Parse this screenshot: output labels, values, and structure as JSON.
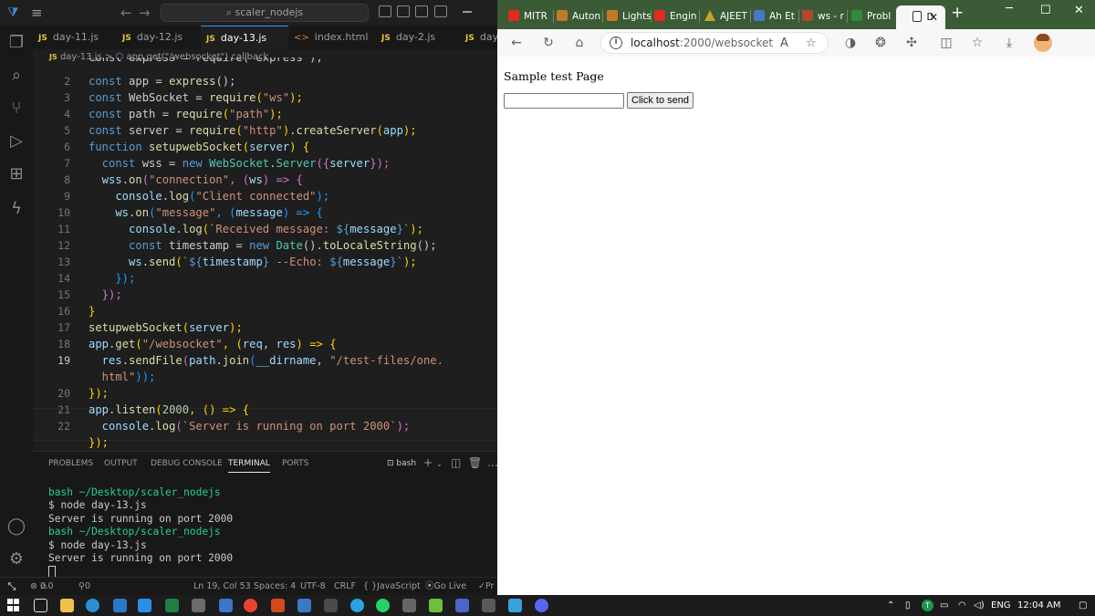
{
  "vscode": {
    "search_text": "scaler_nodejs",
    "tabs": [
      {
        "label": "day-11.js",
        "type": "JS"
      },
      {
        "label": "day-12.js",
        "type": "JS"
      },
      {
        "label": "day-13.js",
        "type": "JS",
        "active": true
      },
      {
        "label": "index.html",
        "type": "<>"
      },
      {
        "label": "day-2.js",
        "type": "JS"
      },
      {
        "label": "day-",
        "type": "JS"
      }
    ],
    "breadcrumb": {
      "file": "day-13.js",
      "sep": ">",
      "symbol": "app.get(\"/websocket\") callback"
    },
    "line_numbers": [
      "2",
      "3",
      "4",
      "5",
      "6",
      "7",
      "8",
      "9",
      "10",
      "11",
      "12",
      "13",
      "14",
      "15",
      "16",
      "17",
      "18",
      "19",
      "",
      "20",
      "21",
      "22"
    ],
    "code": {
      "l1_partial": "const express = require(\"express\");",
      "l2": [
        "const",
        " app = ",
        "express",
        "();"
      ],
      "l3": [
        "const",
        " WebSocket = ",
        "require",
        "(",
        "\"ws\"",
        ");"
      ],
      "l4": [
        "const",
        " path = ",
        "require",
        "(",
        "\"path\"",
        ");"
      ],
      "l5": [
        "const",
        " server = ",
        "require",
        "(",
        "\"http\"",
        ").",
        "createServer",
        "(",
        "app",
        ");"
      ],
      "l6": [
        "function",
        " ",
        "setupwebSocket",
        "(",
        "server",
        ") {"
      ],
      "l7": [
        "  const",
        " wss = ",
        "new",
        " WebSocket",
        ".",
        "Server",
        "({",
        "server",
        "});"
      ],
      "l8": [
        "  wss",
        ".",
        "on",
        "(",
        "\"connection\"",
        ", (",
        "ws",
        ") => {"
      ],
      "l9": [
        "    console",
        ".",
        "log",
        "(",
        "\"Client connected\"",
        ");"
      ],
      "l10": [
        "    ws",
        ".",
        "on",
        "(",
        "\"message\"",
        ", (",
        "message",
        ") => {"
      ],
      "l11": [
        "      console",
        ".",
        "log",
        "(",
        "`Received message: ",
        "${",
        "message",
        "}",
        "`",
        ");"
      ],
      "l12": [
        "      const",
        " timestamp = ",
        "new",
        " Date",
        "().",
        "toLocaleString",
        "();"
      ],
      "l13": [
        "      ws",
        ".",
        "send",
        "(",
        "`",
        "${",
        "timestamp",
        "}",
        " --Echo: ",
        "${",
        "message",
        "}",
        "`",
        ");"
      ],
      "l14": [
        "    });"
      ],
      "l15": [
        "  });"
      ],
      "l16": [
        "}"
      ],
      "l17": [
        "setupwebSocket",
        "(",
        "server",
        ");"
      ],
      "l18": [
        "app",
        ".",
        "get",
        "(",
        "\"/websocket\"",
        ", (",
        "req",
        ", ",
        "res",
        ") => {"
      ],
      "l19a": [
        "  res",
        ".",
        "sendFile",
        "(",
        "path",
        ".",
        "join",
        "(",
        "__dirname",
        ", ",
        "\"/test-files/one."
      ],
      "l19b": [
        "  html\"",
        "));"
      ],
      "l20": [
        "});"
      ],
      "l21": [
        "app",
        ".",
        "listen",
        "(",
        "2000",
        ", () => {"
      ],
      "l22": [
        "  console",
        ".",
        "log",
        "(",
        "`Server is running on port 2000`",
        ");"
      ],
      "l23": [
        "});"
      ]
    },
    "panel_tabs": [
      "PROBLEMS",
      "OUTPUT",
      "DEBUG CONSOLE",
      "TERMINAL",
      "PORTS"
    ],
    "active_panel_tab": "TERMINAL",
    "terminal_shell": "bash",
    "terminal_lines": [
      {
        "prompt": "bash ~/Desktop/scaler_nodejs",
        "green": true
      },
      {
        "text": "$ node day-13.js"
      },
      {
        "text": "Server is running on port 2000"
      },
      {
        "prompt": "bash ~/Desktop/scaler_nodejs",
        "green": true
      },
      {
        "text": "$ node day-13.js"
      },
      {
        "text": "Server is running on port 2000"
      }
    ],
    "status": {
      "problems": "0",
      "warnings": "0",
      "ports": "0",
      "cursor": "Ln 19, Col 53",
      "spaces": "Spaces: 4",
      "encoding": "UTF-8",
      "eol": "CRLF",
      "language": "JavaScript",
      "golive": "Go Live",
      "prettier": "Pr"
    }
  },
  "edge": {
    "tabs": [
      "MITR",
      "Auton",
      "Lights",
      "Engin",
      "AJEET",
      "Ah Et",
      "ws - r",
      "Probl",
      "D"
    ],
    "url_host": "localhost",
    "url_path": ":2000/websocket",
    "page_heading": "Sample test Page",
    "input_value": "",
    "button_label": "Click to send",
    "colors": {
      "tab_bar": "#3a5b36",
      "toolbar": "#f7f7f7"
    }
  },
  "taskbar": {
    "language": "ENG",
    "time": "12:04 AM"
  }
}
